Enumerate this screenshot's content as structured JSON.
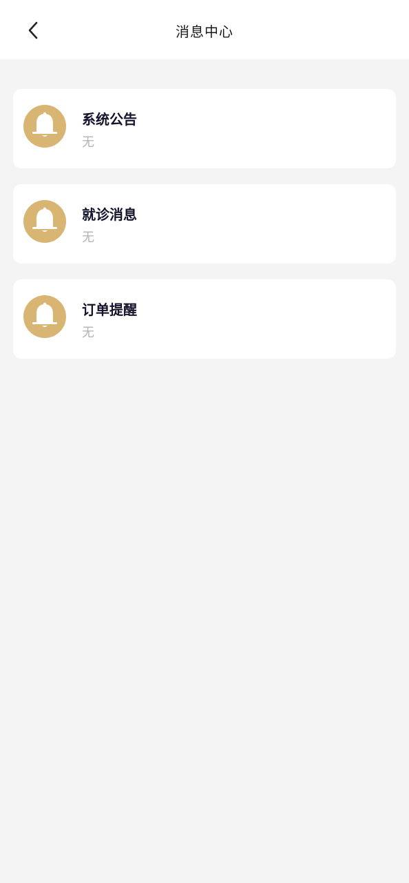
{
  "header": {
    "title": "消息中心",
    "back_icon": "chevron-left-icon"
  },
  "colors": {
    "accent": "#d9b574",
    "background": "#f4f4f4",
    "card": "#ffffff",
    "title_text": "#13132b",
    "sub_text": "#b3b3b3"
  },
  "messages": [
    {
      "title": "系统公告",
      "preview": "无",
      "icon": "bell-icon"
    },
    {
      "title": "就诊消息",
      "preview": "无",
      "icon": "bell-icon"
    },
    {
      "title": "订单提醒",
      "preview": "无",
      "icon": "bell-icon"
    }
  ]
}
